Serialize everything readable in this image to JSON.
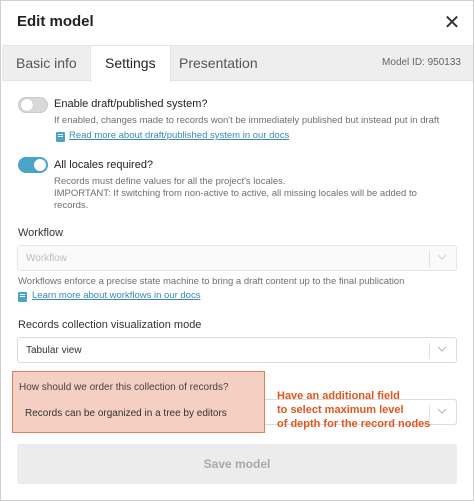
{
  "modal": {
    "title": "Edit model",
    "close_glyph": "✕",
    "close_icon": "close-icon"
  },
  "tabs": [
    {
      "label": "Basic info",
      "active": false
    },
    {
      "label": "Settings",
      "active": true
    },
    {
      "label": "Presentation",
      "active": false
    }
  ],
  "model_id": "Model ID: 950133",
  "draft": {
    "enabled": false,
    "label": "Enable draft/published system?",
    "hint": "If enabled, changes made to records won't be immediately published but instead put in draft",
    "link": "Read more about draft/published system in our docs",
    "link_icon": "book-icon"
  },
  "locales": {
    "enabled": true,
    "label": "All locales required?",
    "hint_line1": "Records must define values for all the project's locales.",
    "hint_line2": "IMPORTANT: If switching from non-active to active, all missing locales will be added to",
    "hint_line3": "records."
  },
  "workflow": {
    "label": "Workflow",
    "placeholder": "Workflow",
    "hint": "Workflows enforce a precise state machine to bring a draft content up to the final publication",
    "link": "Learn more about workflows in our docs",
    "link_icon": "book-icon"
  },
  "visualization": {
    "label": "Records collection visualization mode",
    "value": "Tabular view"
  },
  "ordering": {
    "question": "How should we order this collection of records?",
    "value": "Records can be organized in a tree by editors"
  },
  "annotation": {
    "line1": "Have an additional field",
    "line2": "to select maximum level",
    "line3": "of depth for the record nodes",
    "color": "#e0561f"
  },
  "save_label": "Save model",
  "colors": {
    "accent": "#4aa3c8",
    "link": "#3a88b7",
    "highlight_fill": "#f5cfc2",
    "highlight_border": "#e07d5f"
  }
}
